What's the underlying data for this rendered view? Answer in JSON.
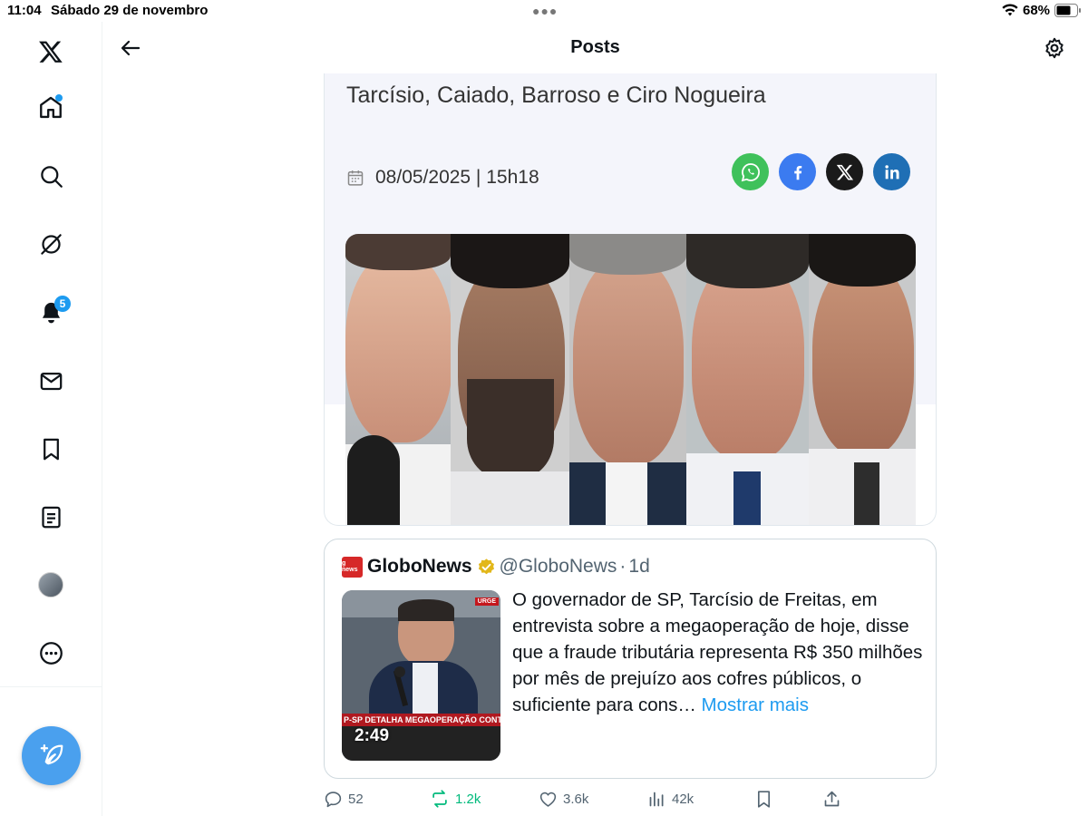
{
  "status_bar": {
    "time": "11:04",
    "date": "Sábado 29 de novembro",
    "battery": "68%"
  },
  "sidebar": {
    "items": [
      {
        "name": "x-logo-icon"
      },
      {
        "name": "home-icon",
        "has_dot": true
      },
      {
        "name": "search-icon"
      },
      {
        "name": "grok-icon"
      },
      {
        "name": "notifications-icon",
        "badge": "5"
      },
      {
        "name": "messages-icon"
      },
      {
        "name": "bookmarks-icon"
      },
      {
        "name": "lists-icon"
      },
      {
        "name": "profile-avatar"
      },
      {
        "name": "more-icon"
      }
    ],
    "compose_icon": "compose-feather-icon"
  },
  "header": {
    "title": "Posts",
    "back_icon": "arrow-left-icon",
    "settings_icon": "gear-icon"
  },
  "article": {
    "title": "Tarcísio, Caiado, Barroso e Ciro Nogueira",
    "date": "08/05/2025 | 15h18",
    "share_buttons": [
      {
        "name": "whatsapp",
        "color": "#3fc15b"
      },
      {
        "name": "facebook",
        "color": "#3b7bf0"
      },
      {
        "name": "x",
        "color": "#1a1a1a"
      },
      {
        "name": "linkedin",
        "color": "#1f6fb5"
      }
    ]
  },
  "quote": {
    "source_logo": "GloboNews",
    "name": "GloboNews",
    "handle": "@GloboNews",
    "separator": "·",
    "time": "1d",
    "text": "O governador de SP, Tarcísio de Freitas, em entrevista sobre a megaoperação de hoje, disse que a fraude tributária representa R$ 350 milhões por mês de prejuízo aos cofres públicos, o suficiente para cons…",
    "more_label": "Mostrar mais",
    "video": {
      "duration": "2:49",
      "banner": "P-SP DETALHA MEGAOPERAÇÃO CONTRA FRAUDE FI",
      "tag": "URGE"
    }
  },
  "actions": {
    "replies": "52",
    "reposts": "1.2k",
    "likes": "3.6k",
    "views": "42k"
  },
  "colors": {
    "accent": "#1d9bf0",
    "repost": "#00ba7c"
  }
}
